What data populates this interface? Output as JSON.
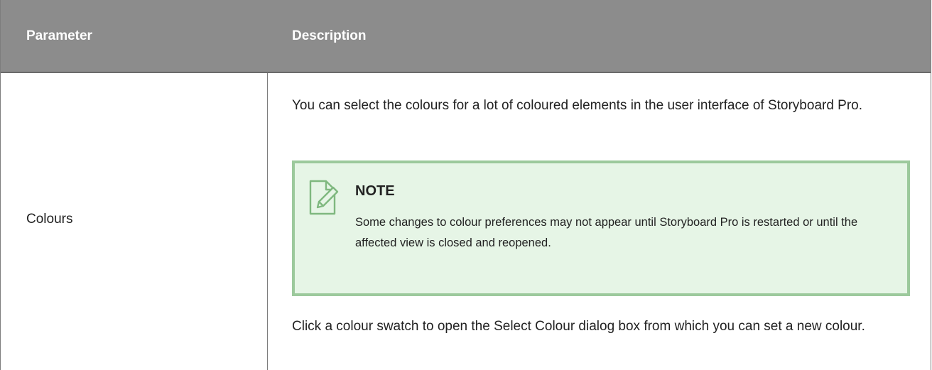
{
  "table": {
    "headers": {
      "parameter": "Parameter",
      "description": "Description"
    },
    "row": {
      "parameter": "Colours",
      "paragraph_1": "You can select the colours for a lot of coloured elements in the user interface of Storyboard Pro.",
      "note": {
        "icon": "note-pencil-icon",
        "title": "NOTE",
        "body": "Some changes to colour preferences may not appear until Storyboard Pro is restarted or until the affected view is closed and reopened."
      },
      "paragraph_2": "Click a colour swatch to open the Select Colour dialog box from which you can set a new colour."
    }
  },
  "colors": {
    "header_bg": "#8c8c8c",
    "header_text": "#ffffff",
    "note_bg": "#e6f5e6",
    "note_border": "#9cc99c",
    "note_icon": "#7fb87f"
  }
}
